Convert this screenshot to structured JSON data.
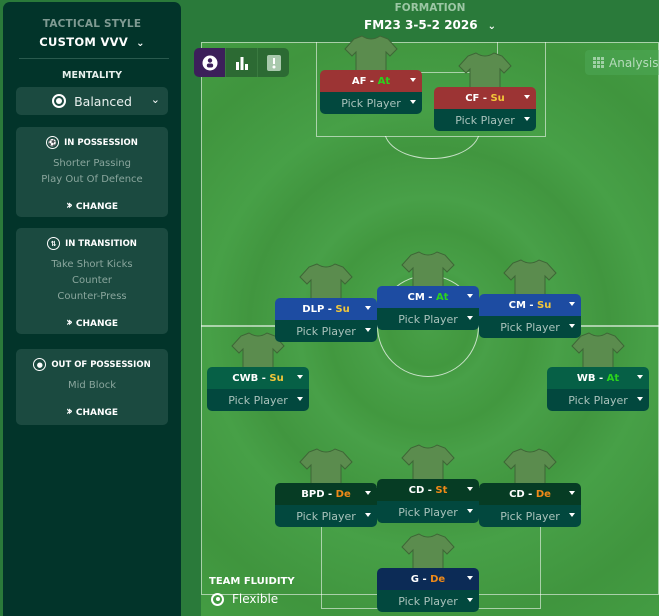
{
  "sidebar": {
    "tactical_style_label": "TACTICAL STYLE",
    "tactical_style_value": "CUSTOM VVV",
    "mentality_label": "MENTALITY",
    "mentality_value": "Balanced",
    "cards": [
      {
        "title": "IN POSSESSION",
        "icon": "ball-icon",
        "lines": [
          "Shorter Passing",
          "Play Out Of Defence"
        ],
        "action": "CHANGE"
      },
      {
        "title": "IN TRANSITION",
        "icon": "transition-icon",
        "lines": [
          "Take Short Kicks",
          "Counter",
          "Counter-Press"
        ],
        "action": "CHANGE"
      },
      {
        "title": "OUT OF POSSESSION",
        "icon": "shield-ball-icon",
        "lines": [
          "Mid Block"
        ],
        "action": "CHANGE"
      }
    ]
  },
  "header": {
    "formation_label": "FORMATION",
    "formation_value": "FM23 3-5-2 2026"
  },
  "toolbar": {
    "view_buttons": [
      "player-view-icon",
      "stats-view-icon",
      "instructions-view-icon"
    ],
    "analysis_label": "Analysis"
  },
  "players": [
    {
      "role": "AF",
      "duty": "At",
      "player": "Pick Player",
      "color": "#9c3434"
    },
    {
      "role": "CF",
      "duty": "Su",
      "player": "Pick Player",
      "color": "#9c3434"
    },
    {
      "role": "DLP",
      "duty": "Su",
      "player": "Pick Player",
      "color": "#1d4ca2"
    },
    {
      "role": "CM",
      "duty": "At",
      "player": "Pick Player",
      "color": "#1d4ca2"
    },
    {
      "role": "CM",
      "duty": "Su",
      "player": "Pick Player",
      "color": "#1d4ca2"
    },
    {
      "role": "CWB",
      "duty": "Su",
      "player": "Pick Player",
      "color": "#066046"
    },
    {
      "role": "WB",
      "duty": "At",
      "player": "Pick Player",
      "color": "#066046"
    },
    {
      "role": "BPD",
      "duty": "De",
      "player": "Pick Player",
      "color": "#063c24"
    },
    {
      "role": "CD",
      "duty": "St",
      "player": "Pick Player",
      "color": "#063c24"
    },
    {
      "role": "CD",
      "duty": "De",
      "player": "Pick Player",
      "color": "#063c24"
    },
    {
      "role": "G",
      "duty": "De",
      "player": "Pick Player",
      "color": "#0c2b56"
    }
  ],
  "fluidity": {
    "label": "TEAM FLUIDITY",
    "value": "Flexible"
  },
  "colors": {
    "attack_duty": "#2bd31e",
    "support_duty": "#f2c73a",
    "defend_duty": "#f08a18",
    "sidebar_bg": "#02342a",
    "pitch": "#45a045"
  }
}
